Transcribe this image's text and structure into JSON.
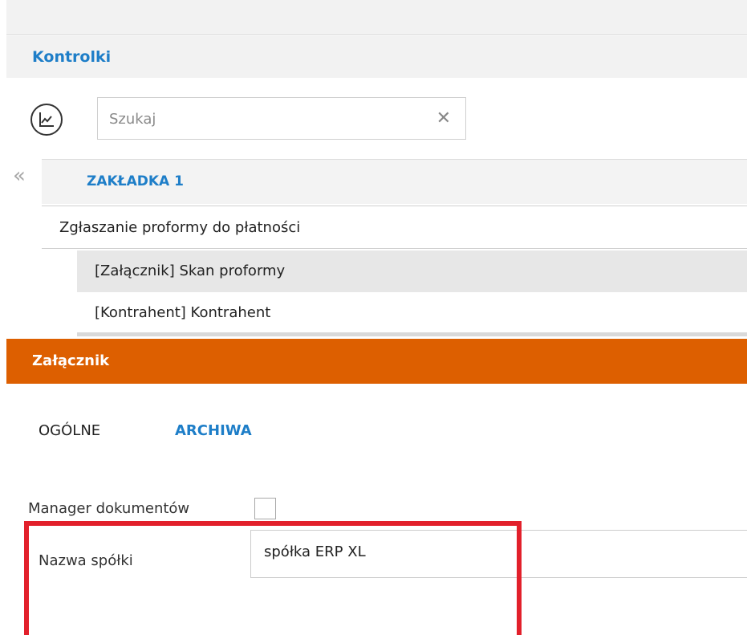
{
  "kontrolki": {
    "title": "Kontrolki",
    "search_placeholder": "Szukaj",
    "clear_symbol": "✕",
    "collapse_symbol": "«"
  },
  "tab": {
    "label": "ZAKŁADKA 1"
  },
  "tree": {
    "group_label": "Zgłaszanie proformy do płatności",
    "items": [
      {
        "label": "[Załącznik] Skan proformy",
        "selected": true
      },
      {
        "label": "[Kontrahent] Kontrahent",
        "selected": false
      }
    ]
  },
  "section": {
    "title": "Załącznik",
    "subtabs": [
      {
        "label": "OGÓLNE",
        "active": false
      },
      {
        "label": "ARCHIWA",
        "active": true
      }
    ]
  },
  "form": {
    "manager_label": "Manager dokumentów",
    "manager_checked": false,
    "company_label": "Nazwa spółki",
    "company_value": "spółka ERP XL"
  },
  "colors": {
    "accent_blue": "#1e7ec8",
    "section_orange": "#dd5f00",
    "highlight_red": "#e2202b"
  },
  "icons": {
    "chart_button": "line-chart-icon",
    "clear": "close-icon",
    "collapse": "double-chevron-left-icon"
  }
}
